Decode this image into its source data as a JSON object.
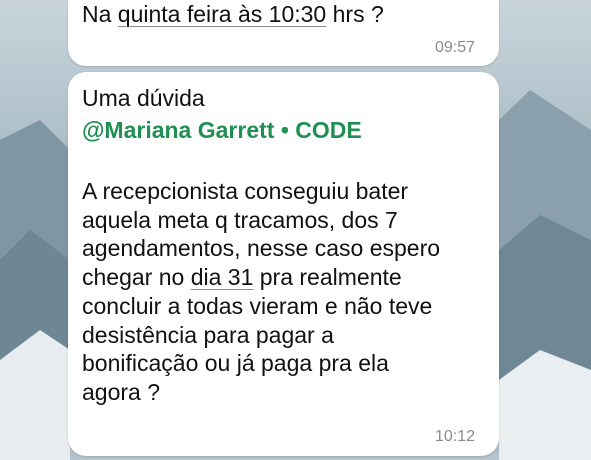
{
  "messages": [
    {
      "text_before": "Na ",
      "text_link": "quinta feira às 10:30",
      "text_after": " hrs ?",
      "time": "09:57"
    },
    {
      "title": "Uma dúvida",
      "mention": "@Mariana Garrett • CODE",
      "body_before": "A recepcionista conseguiu bater\naquela meta q tracamos, dos 7\nagendamentos, nesse caso espero\nchegar no ",
      "body_link": "dia 31",
      "body_after": " pra realmente\nconcluir a todas vieram e não teve\ndesistência para pagar a\nbonificação ou já paga pra ela\nagora ?",
      "time": "10:12"
    }
  ],
  "colors": {
    "mention": "#1f8f52",
    "bubble": "#ffffff",
    "timestamp": "#8b8b8b"
  }
}
